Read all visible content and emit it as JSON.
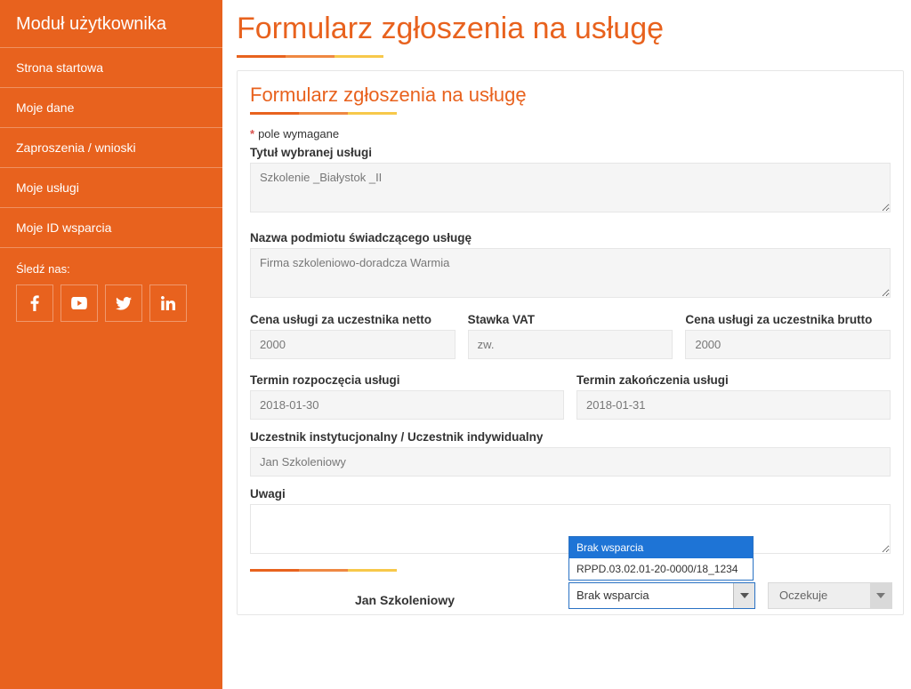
{
  "sidebar": {
    "title": "Moduł użytkownika",
    "items": [
      "Strona startowa",
      "Moje dane",
      "Zaproszenia / wnioski",
      "Moje usługi",
      "Moje ID wsparcia"
    ],
    "follow": "Śledź nas:"
  },
  "page": {
    "title": "Formularz zgłoszenia na usługę"
  },
  "form": {
    "title": "Formularz zgłoszenia na usługę",
    "required_note": "pole wymagane",
    "labels": {
      "service_title": "Tytuł wybranej usługi",
      "provider_name": "Nazwa podmiotu świadczącego usługę",
      "price_net": "Cena usługi za uczestnika netto",
      "vat_rate": "Stawka VAT",
      "price_gross": "Cena usługi za uczestnika brutto",
      "start_date": "Termin rozpoczęcia usługi",
      "end_date": "Termin zakończenia usługi",
      "participant_type": "Uczestnik instytucjonalny / Uczestnik indywidualny",
      "remarks": "Uwagi"
    },
    "values": {
      "service_title": "Szkolenie _Białystok _II",
      "provider_name": "Firma szkoleniowo-doradcza Warmia",
      "price_net": "2000",
      "vat_rate": "zw.",
      "price_gross": "2000",
      "start_date": "2018-01-30",
      "end_date": "2018-01-31",
      "participant_type": "Jan Szkoleniowy",
      "remarks": ""
    }
  },
  "participant_row": {
    "name": "Jan Szkoleniowy",
    "dropdown": {
      "options": [
        "Brak wsparcia",
        "RPPD.03.02.01-20-0000/18_1234"
      ],
      "selected": "Brak wsparcia"
    },
    "status": "Oczekuje"
  }
}
